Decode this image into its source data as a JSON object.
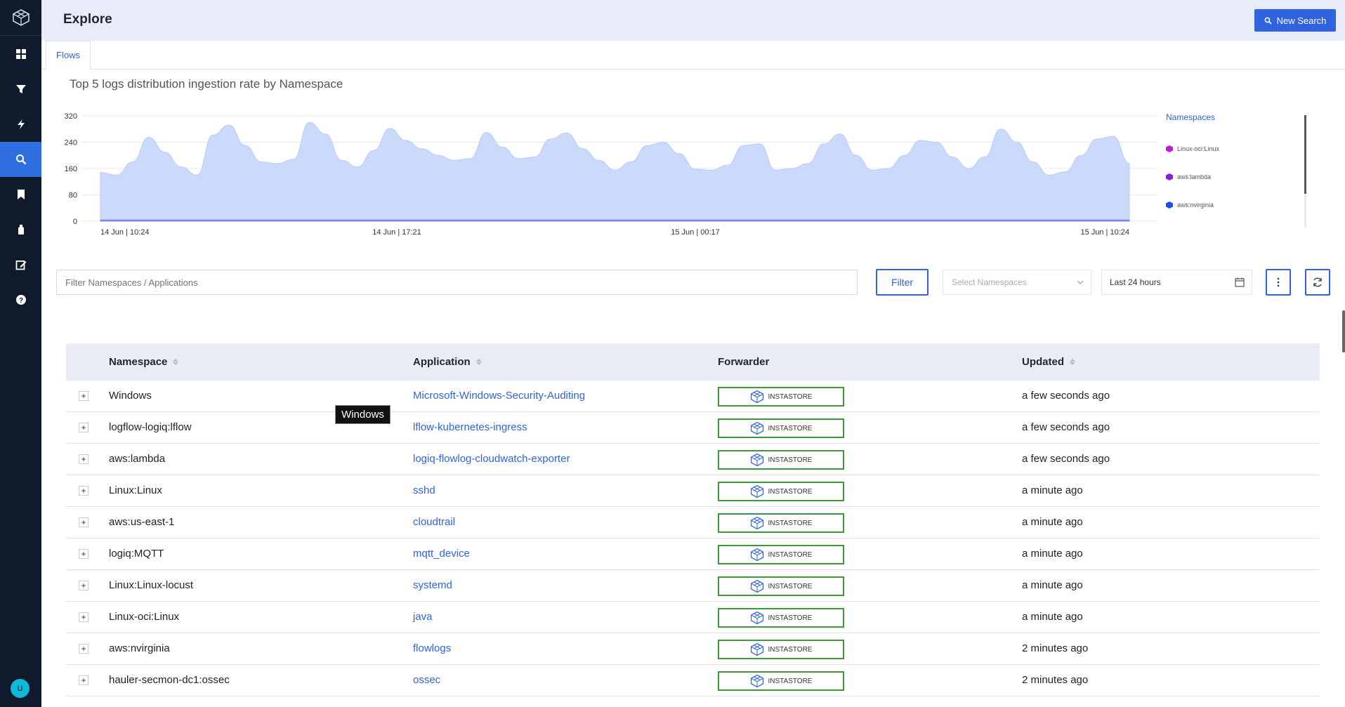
{
  "page": {
    "title": "Explore",
    "new_search_label": "New Search"
  },
  "tabs": [
    {
      "label": "Flows"
    }
  ],
  "chart_data": {
    "type": "area",
    "title": "Top 5 logs distribution ingestion rate by Namespace",
    "x_tick_labels": [
      "14 Jun | 10:24",
      "14 Jun | 17:21",
      "15 Jun | 00:17",
      "15 Jun | 10:24"
    ],
    "y_ticks": [
      0,
      80,
      160,
      240,
      320
    ],
    "ylim": [
      0,
      320
    ],
    "grid": true,
    "legend_position": "right",
    "series": [
      {
        "name": "Linux-oci:Linux",
        "color": "#c41cd6",
        "values": [
          148,
          140,
          180,
          255,
          210,
          165,
          140,
          262,
          292,
          230,
          180,
          175,
          188,
          300,
          265,
          185,
          165,
          215,
          282,
          245,
          220,
          200,
          185,
          190,
          270,
          225,
          190,
          195,
          250,
          268,
          220,
          185,
          155,
          180,
          230,
          240,
          205,
          158,
          155,
          170,
          230,
          235,
          155,
          160,
          175,
          235,
          265,
          200,
          155,
          160,
          200,
          245,
          240,
          195,
          160,
          195,
          280,
          240,
          180,
          140,
          150,
          200,
          250,
          258,
          175
        ]
      },
      {
        "name": "aws:lambda",
        "color": "#8a1ed6",
        "values": [
          4,
          4,
          4,
          4,
          4,
          4,
          4,
          4,
          4,
          4,
          4,
          4,
          4,
          4,
          4,
          4,
          4,
          4,
          4,
          4,
          4,
          4,
          4,
          4,
          4,
          4,
          4,
          4,
          4,
          4,
          4,
          4,
          4,
          4,
          4,
          4,
          4,
          4,
          4,
          4,
          4,
          4,
          4,
          4,
          4,
          4,
          4,
          4,
          4,
          4,
          4,
          4,
          4,
          4,
          4,
          4,
          4,
          4,
          4,
          4,
          4,
          4,
          4,
          4,
          4
        ]
      },
      {
        "name": "aws:nvirginia",
        "color": "#1e4ee0",
        "values": [
          2,
          2,
          2,
          2,
          2,
          2,
          2,
          2,
          2,
          2,
          2,
          2,
          2,
          2,
          2,
          2,
          2,
          2,
          2,
          2,
          2,
          2,
          2,
          2,
          2,
          2,
          2,
          2,
          2,
          2,
          2,
          2,
          2,
          2,
          2,
          2,
          2,
          2,
          2,
          2,
          2,
          2,
          2,
          2,
          2,
          2,
          2,
          2,
          2,
          2,
          2,
          2,
          2,
          2,
          2,
          2,
          2,
          2,
          2,
          2,
          2,
          2,
          2,
          2,
          2
        ]
      }
    ]
  },
  "legend": {
    "title": "Namespaces"
  },
  "filters": {
    "search_placeholder": "Filter Namespaces / Applications",
    "filter_label": "Filter",
    "namespace_placeholder": "Select Namespaces",
    "time_range": "Last 24 hours"
  },
  "table": {
    "headers": {
      "namespace": "Namespace",
      "application": "Application",
      "forwarder": "Forwarder",
      "updated": "Updated"
    },
    "rows": [
      {
        "namespace": "Windows",
        "application": "Microsoft-Windows-Security-Auditing",
        "forwarder": "INSTASTORE",
        "updated": "a few seconds ago"
      },
      {
        "namespace": "logflow-logiq:lflow",
        "application": "lflow-kubernetes-ingress",
        "forwarder": "INSTASTORE",
        "updated": "a few seconds ago"
      },
      {
        "namespace": "aws:lambda",
        "application": "logiq-flowlog-cloudwatch-exporter",
        "forwarder": "INSTASTORE",
        "updated": "a few seconds ago"
      },
      {
        "namespace": "Linux:Linux",
        "application": "sshd",
        "forwarder": "INSTASTORE",
        "updated": "a minute ago"
      },
      {
        "namespace": "aws:us-east-1",
        "application": "cloudtrail",
        "forwarder": "INSTASTORE",
        "updated": "a minute ago"
      },
      {
        "namespace": "logiq:MQTT",
        "application": "mqtt_device",
        "forwarder": "INSTASTORE",
        "updated": "a minute ago"
      },
      {
        "namespace": "Linux:Linux-locust",
        "application": "systemd",
        "forwarder": "INSTASTORE",
        "updated": "a minute ago"
      },
      {
        "namespace": "Linux-oci:Linux",
        "application": "java",
        "forwarder": "INSTASTORE",
        "updated": "a minute ago"
      },
      {
        "namespace": "aws:nvirginia",
        "application": "flowlogs",
        "forwarder": "INSTASTORE",
        "updated": "2 minutes ago"
      },
      {
        "namespace": "hauler-secmon-dc1:ossec",
        "application": "ossec",
        "forwarder": "INSTASTORE",
        "updated": "2 minutes ago"
      }
    ]
  },
  "tooltip": {
    "text": "Windows"
  },
  "user": {
    "initial": "U"
  }
}
